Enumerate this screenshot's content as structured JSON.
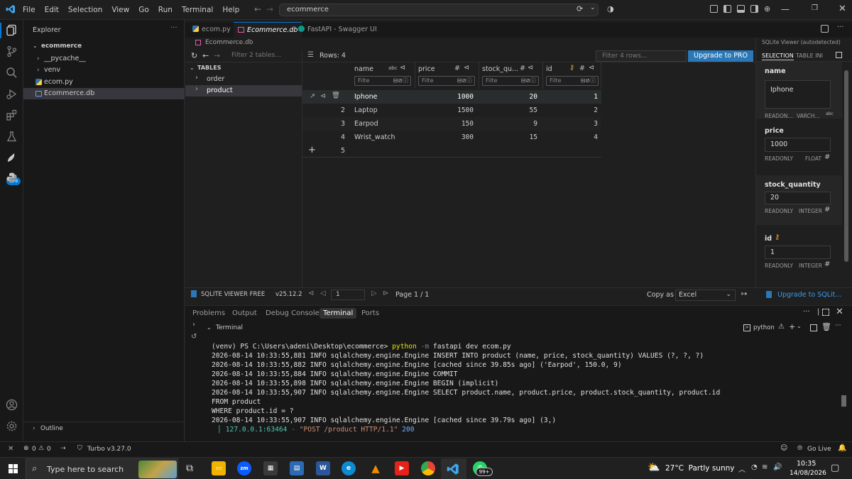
{
  "menu": [
    "File",
    "Edit",
    "Selection",
    "View",
    "Go",
    "Run",
    "Terminal",
    "Help"
  ],
  "search": {
    "value": "ecommerce"
  },
  "activity": {
    "badge": "799"
  },
  "explorer": {
    "title": "Explorer",
    "root": "ecommerce",
    "items": [
      {
        "label": "__pycache__",
        "type": "folder"
      },
      {
        "label": "venv",
        "type": "folder"
      },
      {
        "label": "ecom.py",
        "type": "python"
      },
      {
        "label": "Ecommerce.db",
        "type": "db"
      }
    ],
    "outline": "Outline"
  },
  "tabs": [
    {
      "label": "ecom.py"
    },
    {
      "label": "Ecommerce.db"
    },
    {
      "label": "FastAPI - Swagger UI"
    }
  ],
  "breadcrumb": "Ecommerce.db",
  "viewer": {
    "filter_tables_placeholder": "Filter 2 tables...",
    "rows_label": "Rows: 4",
    "filter_rows_placeholder": "Filter 4 rows...",
    "upgrade_btn": "Upgrade to PRO",
    "tables_heading": "TABLES",
    "tables": [
      "order",
      "product"
    ],
    "columns": [
      {
        "name": "name",
        "type_icon": "abc"
      },
      {
        "name": "price",
        "type_icon": "#"
      },
      {
        "name": "stock_qu...",
        "type_icon": "#"
      },
      {
        "name": "id",
        "type_icon": "#"
      }
    ],
    "filter_placeholder": "Filte",
    "rows": [
      {
        "num": "1",
        "name": "Iphone",
        "price": "1000",
        "stock": "20",
        "id": "1"
      },
      {
        "num": "2",
        "name": "Laptop",
        "price": "1500",
        "stock": "55",
        "id": "2"
      },
      {
        "num": "3",
        "name": "Earpod",
        "price": "150",
        "stock": "9",
        "id": "3"
      },
      {
        "num": "4",
        "name": "Wrist_watch",
        "price": "300",
        "stock": "15",
        "id": "4"
      }
    ],
    "new_row_num": "5",
    "footer": {
      "brand": "SQLITE VIEWER FREE",
      "version": "v25.12.2",
      "page_input": "1",
      "page_label": "Page 1 / 1",
      "copy_as": "Copy as",
      "format": "Excel",
      "upgrade_link": "Upgrade to SQLit..."
    }
  },
  "detail": {
    "header": "SQLite Viewer (autodetected)",
    "tab_selection": "SELECTION",
    "tab_table": "TABLE INI",
    "fields": [
      {
        "name": "name",
        "value": "Iphone",
        "meta_left": "READON...",
        "meta_right": "VARCH...",
        "type_icon": "abc"
      },
      {
        "name": "price",
        "value": "1000",
        "meta_left": "READONLY",
        "meta_right": "FLOAT",
        "type_icon": "#"
      },
      {
        "name": "stock_quantity",
        "value": "20",
        "meta_left": "READONLY",
        "meta_right": "INTEGER",
        "type_icon": "#"
      },
      {
        "name": "id",
        "value": "1",
        "meta_left": "READONLY",
        "meta_right": "INTEGER",
        "type_icon": "#"
      }
    ]
  },
  "panel": {
    "tabs": [
      "Problems",
      "Output",
      "Debug Console",
      "Terminal",
      "Ports"
    ],
    "section": "Terminal",
    "shell": "python",
    "lines": [
      {
        "prompt": "(venv) PS C:\\Users\\adeni\\Desktop\\ecommerce> ",
        "cmd": "python",
        "flag": " -m",
        "args": " fastapi dev ecom.py"
      },
      {
        "text": "2026-08-14 10:33:55,881 INFO sqlalchemy.engine.Engine INSERT INTO product (name, price, stock_quantity) VALUES (?, ?, ?)"
      },
      {
        "text": "2026-08-14 10:33:55,882 INFO sqlalchemy.engine.Engine [cached since 39.85s ago] ('Earpod', 150.0, 9)"
      },
      {
        "text": "2026-08-14 10:33:55,884 INFO sqlalchemy.engine.Engine COMMIT"
      },
      {
        "text": "2026-08-14 10:33:55,898 INFO sqlalchemy.engine.Engine BEGIN (implicit)"
      },
      {
        "text": "2026-08-14 10:33:55,907 INFO sqlalchemy.engine.Engine SELECT product.name, product.price, product.stock_quantity, product.id"
      },
      {
        "text": "FROM product"
      },
      {
        "text": "WHERE product.id = ?"
      },
      {
        "text": "2026-08-14 10:33:55,907 INFO sqlalchemy.engine.Engine [cached since 39.79s ago] (3,)"
      }
    ],
    "http": {
      "addr": "127.0.0.1:63464",
      "sep": " - ",
      "req": "\"POST /product HTTP/1.1\"",
      "status": " 200"
    }
  },
  "status": {
    "errors": "0",
    "warnings": "0",
    "turbo": "Turbo v3.27.0",
    "golive": "Go Live"
  },
  "taskbar": {
    "search_placeholder": "Type here to search",
    "weather": "27°C  Partly sunny",
    "time": "10:35",
    "date": "14/08/2026",
    "whatsapp_badge": "99+"
  },
  "colors": {
    "accent": "#0078d4",
    "upgrade": "#2a78b8",
    "selected_row": "#2a2d2e",
    "key_icon": "#e2a23b",
    "http_addr": "#4ec9b0",
    "http_req": "#ce9178",
    "http_status": "#6cb6ff"
  }
}
